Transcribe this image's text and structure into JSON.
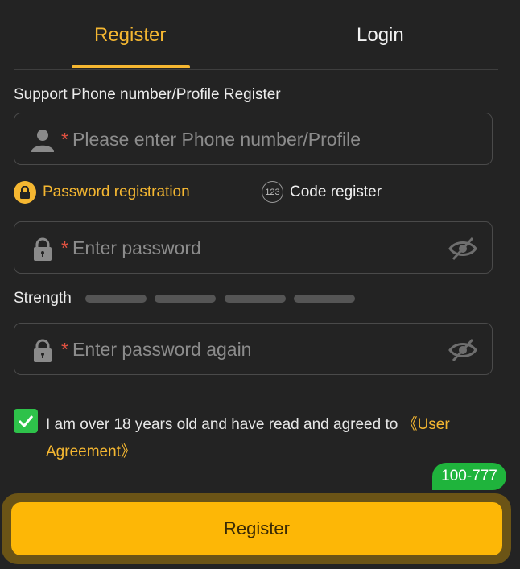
{
  "tabs": {
    "register": "Register",
    "login": "Login"
  },
  "support_label": "Support Phone number/Profile Register",
  "fields": {
    "required_mark": "*",
    "account_placeholder": "Please enter Phone number/Profile",
    "password_placeholder": "Enter password",
    "confirm_placeholder": "Enter password again"
  },
  "modes": {
    "password": "Password registration",
    "code": "Code register",
    "code_badge": "123"
  },
  "strength_label": "Strength",
  "strength_level": 0,
  "agreement": {
    "text": "I am over 18 years old and have read and agreed to ",
    "link": "《User Agreement》",
    "checked": true
  },
  "promo_badge": "100-777",
  "register_button": "Register",
  "colors": {
    "accent": "#f5b731",
    "button": "#fdb706",
    "check": "#2ec24a",
    "required": "#e25241"
  }
}
